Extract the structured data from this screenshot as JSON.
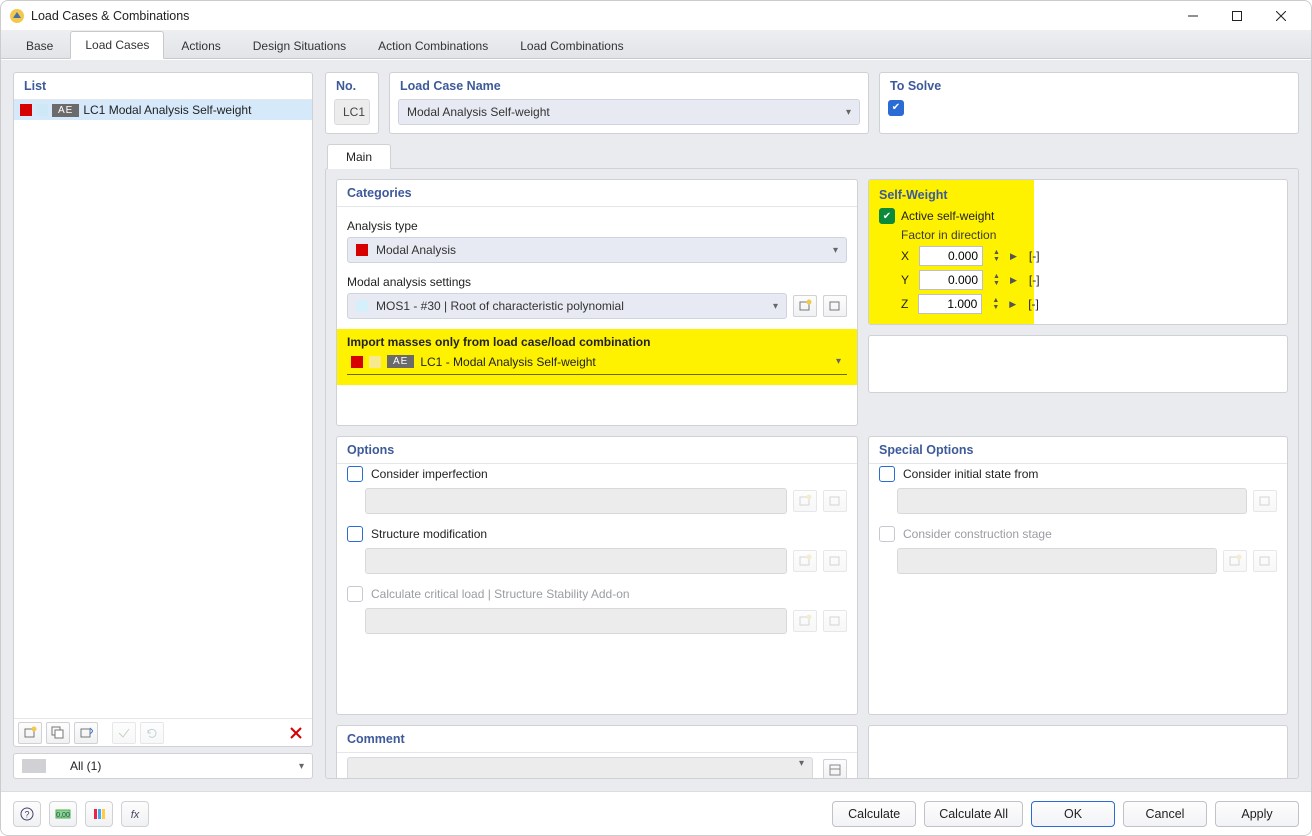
{
  "window": {
    "title": "Load Cases & Combinations"
  },
  "tabs": {
    "base": "Base",
    "load_cases": "Load Cases",
    "actions": "Actions",
    "design_situations": "Design Situations",
    "action_combinations": "Action Combinations",
    "load_combinations": "Load Combinations"
  },
  "list": {
    "title": "List",
    "item_badge": "AE",
    "item_text": "LC1  Modal Analysis Self-weight",
    "filter_text": "All (1)"
  },
  "header": {
    "no_title": "No.",
    "no_value": "LC1",
    "name_title": "Load Case Name",
    "name_value": "Modal Analysis Self-weight",
    "tosolve_title": "To Solve"
  },
  "main_tab": "Main",
  "categories": {
    "title": "Categories",
    "analysis_type_label": "Analysis type",
    "analysis_type_value": "Modal Analysis",
    "masettings_label": "Modal analysis settings",
    "masettings_value": "MOS1 - #30 | Root of characteristic polynomial",
    "import_label": "Import masses only from load case/load combination",
    "import_badge": "AE",
    "import_value": "LC1 - Modal Analysis Self-weight"
  },
  "self_weight": {
    "title": "Self-Weight",
    "active_label": "Active self-weight",
    "fid_label": "Factor in direction",
    "x_label": "X",
    "x_value": "0.000",
    "x_unit": "[-]",
    "y_label": "Y",
    "y_value": "0.000",
    "y_unit": "[-]",
    "z_label": "Z",
    "z_value": "1.000",
    "z_unit": "[-]"
  },
  "options": {
    "title": "Options",
    "imperfection": "Consider imperfection",
    "struct_mod": "Structure modification",
    "crit_load": "Calculate critical load | Structure Stability Add-on"
  },
  "special": {
    "title": "Special Options",
    "init_state": "Consider initial state from",
    "constr_stage": "Consider construction stage"
  },
  "comment": {
    "title": "Comment"
  },
  "footer": {
    "calculate": "Calculate",
    "calculate_all": "Calculate All",
    "ok": "OK",
    "cancel": "Cancel",
    "apply": "Apply"
  }
}
